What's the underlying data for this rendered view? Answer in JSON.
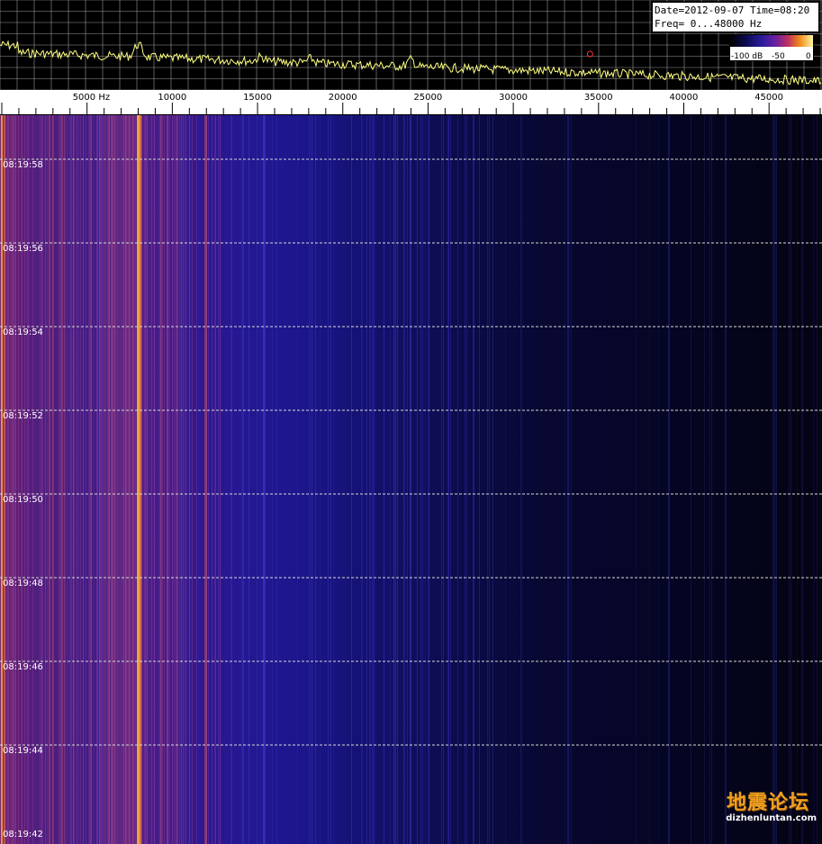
{
  "info": {
    "date_time": "Date=2012-09-07 Time=08:20",
    "freq_range": "Freq= 0...48000 Hz"
  },
  "colorbar": {
    "label_min": "-100 dB",
    "label_mid": "-50",
    "label_max": "0",
    "gradient_colors": [
      "#000000",
      "#0b0b55",
      "#2a1b9a",
      "#6a1fa0",
      "#c0305e",
      "#f08a1a",
      "#fff7a0"
    ]
  },
  "frequency_axis": {
    "ticks": [
      {
        "value": 5000,
        "label": "5000 Hz"
      },
      {
        "value": 10000,
        "label": "10000"
      },
      {
        "value": 15000,
        "label": "15000"
      },
      {
        "value": 20000,
        "label": "20000"
      },
      {
        "value": 25000,
        "label": "25000"
      },
      {
        "value": 30000,
        "label": "30000"
      },
      {
        "value": 35000,
        "label": "35000"
      },
      {
        "value": 40000,
        "label": "40000"
      },
      {
        "value": 45000,
        "label": "45000"
      }
    ],
    "max_hz": 48000
  },
  "time_axis": {
    "labels": [
      "08:19:58",
      "08:19:56",
      "08:19:54",
      "08:19:52",
      "08:19:50",
      "08:19:48",
      "08:19:46",
      "08:19:44",
      "08:19:42"
    ]
  },
  "spectrum": {
    "trace_color": "#ffff80",
    "grid_color": "#9a9a9a",
    "peaks_hz": [
      8000,
      24000,
      34500
    ]
  },
  "watermark": {
    "title": "地震论坛",
    "url": "dizhenluntan.com"
  }
}
